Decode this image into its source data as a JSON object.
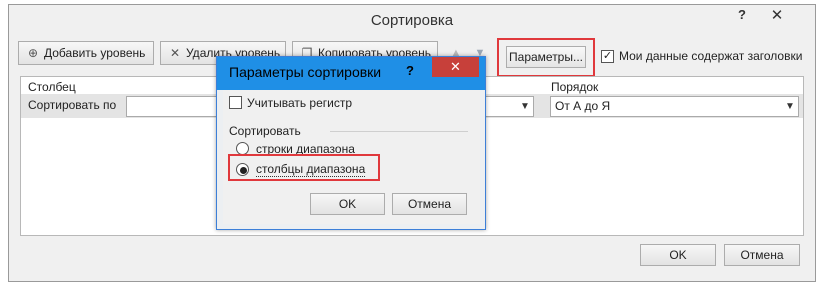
{
  "dialog": {
    "title": "Сортировка",
    "help_glyph": "?",
    "close_glyph": "✕",
    "toolbar": {
      "add_level": "Добавить уровень",
      "delete_level": "Удалить уровень",
      "copy_level": "Копировать уровень",
      "options": "Параметры...",
      "has_headers_label": "Мои данные содержат заголовки",
      "has_headers_checked": true
    },
    "grid": {
      "column_header": "Столбец",
      "order_header": "Порядок",
      "rows": [
        {
          "label": "Сортировать по",
          "column_value": "",
          "order_value": "От А до Я"
        }
      ]
    },
    "ok_label": "OK",
    "cancel_label": "Отмена"
  },
  "options_dialog": {
    "title": "Параметры сортировки",
    "help_glyph": "?",
    "close_glyph": "✕",
    "case_sensitive_label": "Учитывать регистр",
    "case_sensitive_checked": false,
    "orientation_group_label": "Сортировать",
    "orientation_options": [
      "строки диапазона",
      "столбцы диапазона"
    ],
    "orientation_selected": "столбцы диапазона",
    "ok_label": "OK",
    "cancel_label": "Отмена"
  },
  "colors": {
    "highlight": "#e0383c",
    "inner_title_bar": "#1f8fe6",
    "close_button": "#c7403a"
  },
  "icons": {
    "add": "add-level-icon",
    "delete": "delete-icon",
    "copy": "copy-icon",
    "move_up": "arrow-up-icon",
    "move_down": "arrow-down-icon"
  }
}
